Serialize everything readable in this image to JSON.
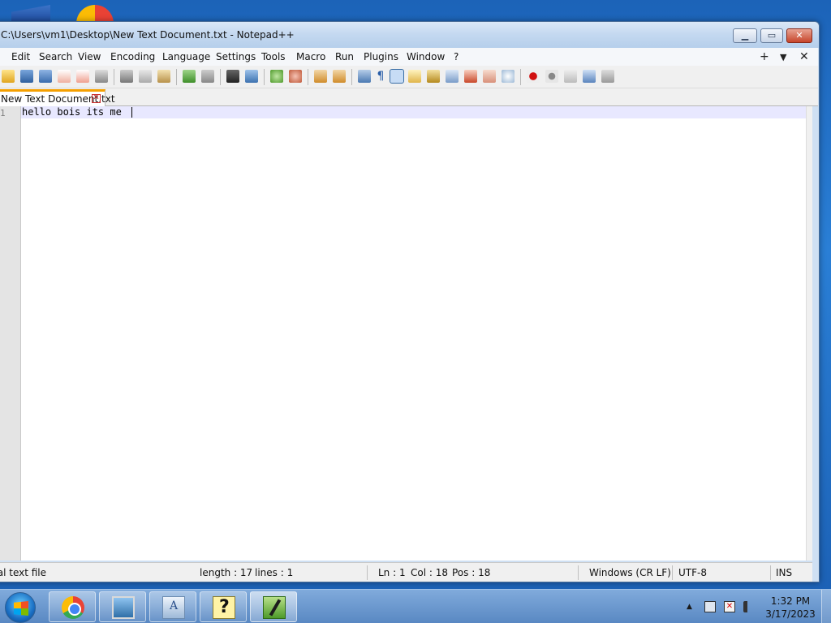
{
  "window": {
    "title": "C:\\Users\\vm1\\Desktop\\New Text Document.txt - Notepad++",
    "min_glyph": "▁",
    "max_glyph": "▭",
    "close_glyph": "✕"
  },
  "menu": {
    "items": [
      {
        "id": "edit",
        "label": "Edit"
      },
      {
        "id": "search",
        "label": "Search"
      },
      {
        "id": "view",
        "label": "View"
      },
      {
        "id": "encoding",
        "label": "Encoding"
      },
      {
        "id": "language",
        "label": "Language"
      },
      {
        "id": "settings",
        "label": "Settings"
      },
      {
        "id": "tools",
        "label": "Tools"
      },
      {
        "id": "macro",
        "label": "Macro"
      },
      {
        "id": "run",
        "label": "Run"
      },
      {
        "id": "plugins",
        "label": "Plugins"
      },
      {
        "id": "window",
        "label": "Window"
      },
      {
        "id": "help",
        "label": "?"
      }
    ],
    "right_plus": "+",
    "right_down": "▼",
    "right_close": "✕"
  },
  "toolbar": {
    "icons": [
      "open-icon",
      "save-icon",
      "save-all-icon",
      "close-icon",
      "close-all-icon",
      "print-icon",
      "cut-icon",
      "copy-icon",
      "paste-icon",
      "undo-icon",
      "redo-icon",
      "find-icon",
      "replace-icon",
      "zoom-in-icon",
      "zoom-out-icon",
      "sync-vertical-icon",
      "sync-horizontal-icon",
      "word-wrap-icon",
      "show-all-chars-icon",
      "indent-guide-icon",
      "user-language-icon",
      "doc-map-icon",
      "function-list-icon",
      "folder-workspace-icon",
      "monitoring-icon",
      "eye-icon",
      "record-macro-icon",
      "stop-record-icon",
      "play-macro-icon",
      "run-macro-multiple-icon",
      "save-macro-icon"
    ],
    "active": "indent-guide-icon",
    "pilcrow": "¶"
  },
  "tabs": [
    {
      "label": "New Text Document.txt",
      "close": "✕"
    }
  ],
  "editor": {
    "line_number": "1",
    "content": "hello bois its me"
  },
  "status": {
    "file_type": "Normal text file",
    "length": "length : 17",
    "lines": "lines : 1",
    "ln": "Ln : 1",
    "col": "Col : 18",
    "pos": "Pos : 18",
    "eol": "Windows (CR LF)",
    "encoding": "UTF-8",
    "mode": "INS"
  },
  "taskbar": {
    "tray_arrow": "▲",
    "clock_time": "1:32 PM",
    "clock_date": "3/17/2023"
  },
  "colors": {
    "tab_accent": "#f5a000",
    "current_line": "#e8e8ff",
    "record_red": "#d01010"
  }
}
